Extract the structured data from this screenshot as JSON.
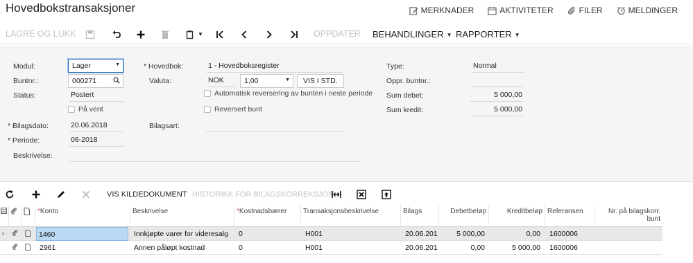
{
  "header": {
    "title": "Hovedbokstransaksjoner",
    "links": [
      "MERKNADER",
      "AKTIVITETER",
      "FILER",
      "MELDINGER"
    ]
  },
  "toolbar": {
    "save_close": "LAGRE OG LUKK",
    "update": "OPPDATER",
    "actions": "BEHANDLINGER",
    "reports": "RAPPORTER"
  },
  "form": {
    "module_label": "Modul:",
    "module_value": "Lager",
    "batch_label": "Buntnr.:",
    "batch_value": "000271",
    "status_label": "Status:",
    "status_value": "Postert",
    "on_hold_label": "På vent",
    "doc_date_label": "Bilagsdato:",
    "doc_date_value": "20.06.2018",
    "period_label": "Periode:",
    "period_value": "06-2018",
    "description_label": "Beskrivelse:",
    "ledger_label": "Hovedbok:",
    "ledger_value": "1 - Hovedboksregister",
    "currency_label": "Valuta:",
    "currency_value": "NOK",
    "rate_value": "1,00",
    "base_button": "VIS I STD.",
    "auto_reverse_label": "Automatisk reversering av bunten i neste periode",
    "reversed_label": "Reversert bunt",
    "doc_type_label": "Bilagsart:",
    "type_label": "Type:",
    "type_value": "Normal",
    "orig_batch_label": "Oppr. buntnr.:",
    "debit_total_label": "Sum debet:",
    "debit_total_value": "5 000,00",
    "credit_total_label": "Sum kredit:",
    "credit_total_value": "5 000,00"
  },
  "grid_toolbar": {
    "view_source": "VIS KILDEDOKUMENT",
    "history": "HISTORIKK FOR BILAGSKORREKSJON"
  },
  "table": {
    "headers": {
      "account": "Konto",
      "description": "Beskrivelse",
      "subaccount": "Kostnadsbærer",
      "tran_desc": "Transaksjonsbeskrivelse",
      "doc": "Bilags",
      "debit": "Debetbeløp",
      "credit": "Kreditbeløp",
      "reference": "Referansen",
      "corr": "Nr. på bilagskorr. bunt"
    },
    "rows": [
      {
        "account": "1460",
        "description": "Innkjøpte varer for videresalg",
        "subaccount": "0",
        "tran_desc": "H001",
        "doc": "20.06.201",
        "debit": "5 000,00",
        "credit": "0,00",
        "reference": "1600006",
        "corr": ""
      },
      {
        "account": "2961",
        "description": "Annen påløpt kostnad",
        "subaccount": "0",
        "tran_desc": "H001",
        "doc": "20.06.201",
        "debit": "0,00",
        "credit": "5 000,00",
        "reference": "1600006",
        "corr": ""
      }
    ]
  }
}
